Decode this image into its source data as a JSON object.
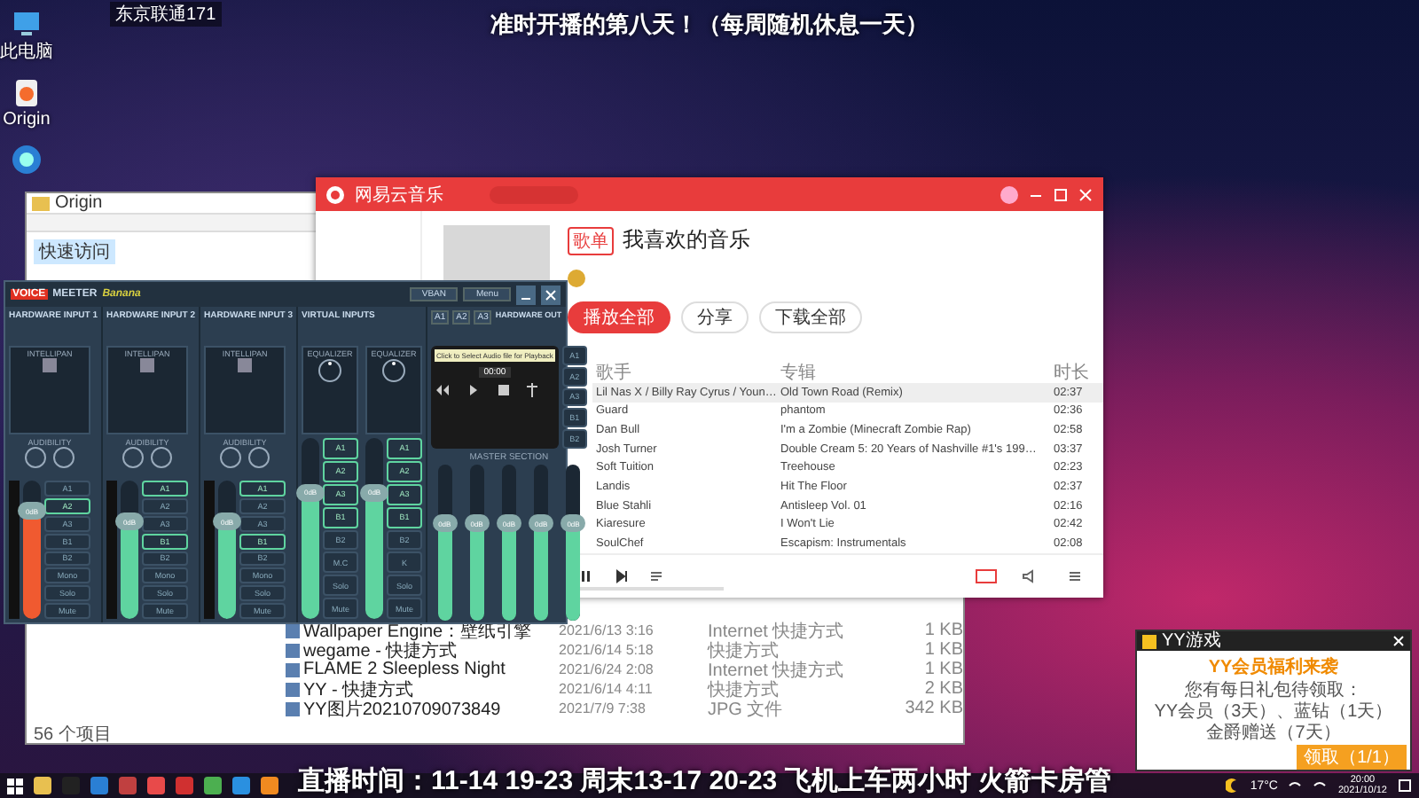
{
  "overlay": {
    "channel": "东京联通171",
    "top_caption": "准时开播的第八天！（每周随机休息一天）",
    "bottom_caption": "直播时间：11-14 19-23 周末13-17 20-23 飞机上车两小时 火箭卡房管"
  },
  "desktop_icons": [
    {
      "label": "此电脑"
    },
    {
      "label": "Origin"
    }
  ],
  "explorer": {
    "path": "Origin",
    "quick_access": "快速访问",
    "files": [
      {
        "name": "Wallpaper Engine：壁纸引擎",
        "date": "2021/6/13 3:16",
        "type": "Internet 快捷方式",
        "size": "1 KB"
      },
      {
        "name": "wegame - 快捷方式",
        "date": "2021/6/14 5:18",
        "type": "快捷方式",
        "size": "1 KB"
      },
      {
        "name": "FLAME 2  Sleepless Night",
        "date": "2021/6/24 2:08",
        "type": "Internet 快捷方式",
        "size": "1 KB"
      },
      {
        "name": "YY - 快捷方式",
        "date": "2021/6/14 4:11",
        "type": "快捷方式",
        "size": "2 KB"
      },
      {
        "name": "YY图片20210709073849",
        "date": "2021/7/9 7:38",
        "type": "JPG 文件",
        "size": "342 KB"
      }
    ],
    "status": "56 个项目"
  },
  "music": {
    "app_name": "网易云音乐",
    "playlist_tag": "歌单",
    "playlist_title": "我喜欢的音乐",
    "actions": [
      {
        "kind": "primary",
        "label": "播放全部"
      },
      {
        "kind": "plain",
        "label": "分享"
      },
      {
        "kind": "plain",
        "label": "下载全部"
      }
    ],
    "columns": [
      "歌手",
      "专辑",
      "时长"
    ],
    "rows": [
      {
        "artist": "Lil Nas X / Billy Ray Cyrus / Youn…",
        "album": "Old Town Road (Remix)",
        "duration": "02:37",
        "selected": true
      },
      {
        "artist": "Guard",
        "album": "phantom",
        "duration": "02:36",
        "selected": false
      },
      {
        "artist": "Dan Bull",
        "album": "I'm a Zombie (Minecraft Zombie Rap)",
        "duration": "02:58",
        "selected": false
      },
      {
        "artist": "Josh Turner",
        "album": "Double Cream 5: 20 Years of Nashville #1's 199…",
        "duration": "03:37",
        "selected": false
      },
      {
        "artist": "Soft Tuition",
        "album": "Treehouse",
        "duration": "02:23",
        "selected": false
      },
      {
        "artist": "Landis",
        "album": "Hit The Floor",
        "duration": "02:37",
        "selected": false
      },
      {
        "artist": "Blue Stahli",
        "album": "Antisleep Vol. 01",
        "duration": "02:16",
        "selected": false
      },
      {
        "artist": "Kiaresure",
        "album": "I Won't Lie",
        "duration": "02:42",
        "selected": false
      },
      {
        "artist": "SoulChef",
        "album": "Escapism: Instrumentals",
        "duration": "02:08",
        "selected": false
      }
    ],
    "progress": {
      "level": 0.12
    }
  },
  "voicemeeter": {
    "logo_voice": "VOICE",
    "logo_meeter": "MEETER",
    "edition": "Banana",
    "vban": "VBAN",
    "menu": "Menu",
    "groups": [
      {
        "title": "HARDWARE INPUT 1",
        "strips": [
          {
            "kind": "intellipan",
            "panel": "INTELLIPAN",
            "knobs": "AUDIBILITY",
            "gain": "0dB",
            "level": 0.78,
            "active": true,
            "buttons": [
              {
                "label": "A1",
                "selected": false
              },
              {
                "label": "A2",
                "selected": true
              },
              {
                "label": "A3",
                "selected": false
              },
              {
                "label": "B1",
                "selected": false
              },
              {
                "label": "B2",
                "selected": false
              },
              {
                "label": "Mono",
                "selected": false
              },
              {
                "label": "Solo",
                "selected": false
              },
              {
                "label": "Mute",
                "selected": false
              }
            ]
          }
        ]
      },
      {
        "title": "HARDWARE INPUT 2",
        "strips": [
          {
            "kind": "intellipan",
            "panel": "INTELLIPAN",
            "knobs": "AUDIBILITY",
            "gain": "0dB",
            "level": 0.7,
            "active": false,
            "buttons": [
              {
                "label": "A1",
                "selected": true
              },
              {
                "label": "A2",
                "selected": false
              },
              {
                "label": "A3",
                "selected": false
              },
              {
                "label": "B1",
                "selected": true
              },
              {
                "label": "B2",
                "selected": false
              },
              {
                "label": "Mono",
                "selected": false
              },
              {
                "label": "Solo",
                "selected": false
              },
              {
                "label": "Mute",
                "selected": false
              }
            ]
          }
        ]
      },
      {
        "title": "HARDWARE INPUT 3",
        "strips": [
          {
            "kind": "intellipan",
            "panel": "INTELLIPAN",
            "knobs": "AUDIBILITY",
            "gain": "0dB",
            "level": 0.7,
            "active": false,
            "buttons": [
              {
                "label": "A1",
                "selected": true
              },
              {
                "label": "A2",
                "selected": false
              },
              {
                "label": "A3",
                "selected": false
              },
              {
                "label": "B1",
                "selected": true
              },
              {
                "label": "B2",
                "selected": false
              },
              {
                "label": "Mono",
                "selected": false
              },
              {
                "label": "Solo",
                "selected": false
              },
              {
                "label": "Mute",
                "selected": false
              }
            ]
          }
        ]
      },
      {
        "title": "VIRTUAL INPUTS",
        "strips": [
          {
            "kind": "equalizer",
            "panel": "EQUALIZER",
            "gain": "0dB",
            "level": 0.7,
            "active": false,
            "buttons": [
              {
                "label": "A1",
                "selected": true
              },
              {
                "label": "A2",
                "selected": true
              },
              {
                "label": "A3",
                "selected": true
              },
              {
                "label": "B1",
                "selected": true
              },
              {
                "label": "B2",
                "selected": false
              },
              {
                "label": "M.C",
                "selected": false
              },
              {
                "label": "Solo",
                "selected": false
              },
              {
                "label": "Mute",
                "selected": false
              }
            ]
          },
          {
            "kind": "equalizer",
            "panel": "EQUALIZER",
            "gain": "0dB",
            "level": 0.7,
            "active": false,
            "buttons": [
              {
                "label": "A1",
                "selected": true
              },
              {
                "label": "A2",
                "selected": true
              },
              {
                "label": "A3",
                "selected": true
              },
              {
                "label": "B1",
                "selected": true
              },
              {
                "label": "B2",
                "selected": false
              },
              {
                "label": "K",
                "selected": false
              },
              {
                "label": "Solo",
                "selected": false
              },
              {
                "label": "Mute",
                "selected": false
              }
            ]
          }
        ]
      }
    ],
    "out_selectors": [
      "A1",
      "A2",
      "A3"
    ],
    "hardware_out": "HARDWARE OUT",
    "cassette_label": "Click to Select Audio file for Playback",
    "cassette_time": "00:00",
    "out_buttons": [
      {
        "label": "A1",
        "selected": false
      },
      {
        "label": "A2",
        "selected": false
      },
      {
        "label": "A3",
        "selected": false
      },
      {
        "label": "B1",
        "selected": false
      },
      {
        "label": "B2",
        "selected": false
      }
    ],
    "master": "MASTER SECTION",
    "buses": [
      {
        "gain": "0dB",
        "level": 0.62
      },
      {
        "gain": "0dB",
        "level": 0.62
      },
      {
        "gain": "0dB",
        "level": 0.62
      },
      {
        "gain": "0dB",
        "level": 0.62
      },
      {
        "gain": "0dB",
        "level": 0.62
      }
    ]
  },
  "popup": {
    "app": "YY游戏",
    "heading": "YY会员福利来袭",
    "lines": [
      "您有每日礼包待领取：",
      "YY会员（3天）、蓝钻（1天）",
      "金爵赠送（7天）"
    ],
    "button": "领取（1/1）"
  },
  "taskbar": {
    "weather": "17°C",
    "time": "20:00",
    "date": "2021/10/12"
  }
}
